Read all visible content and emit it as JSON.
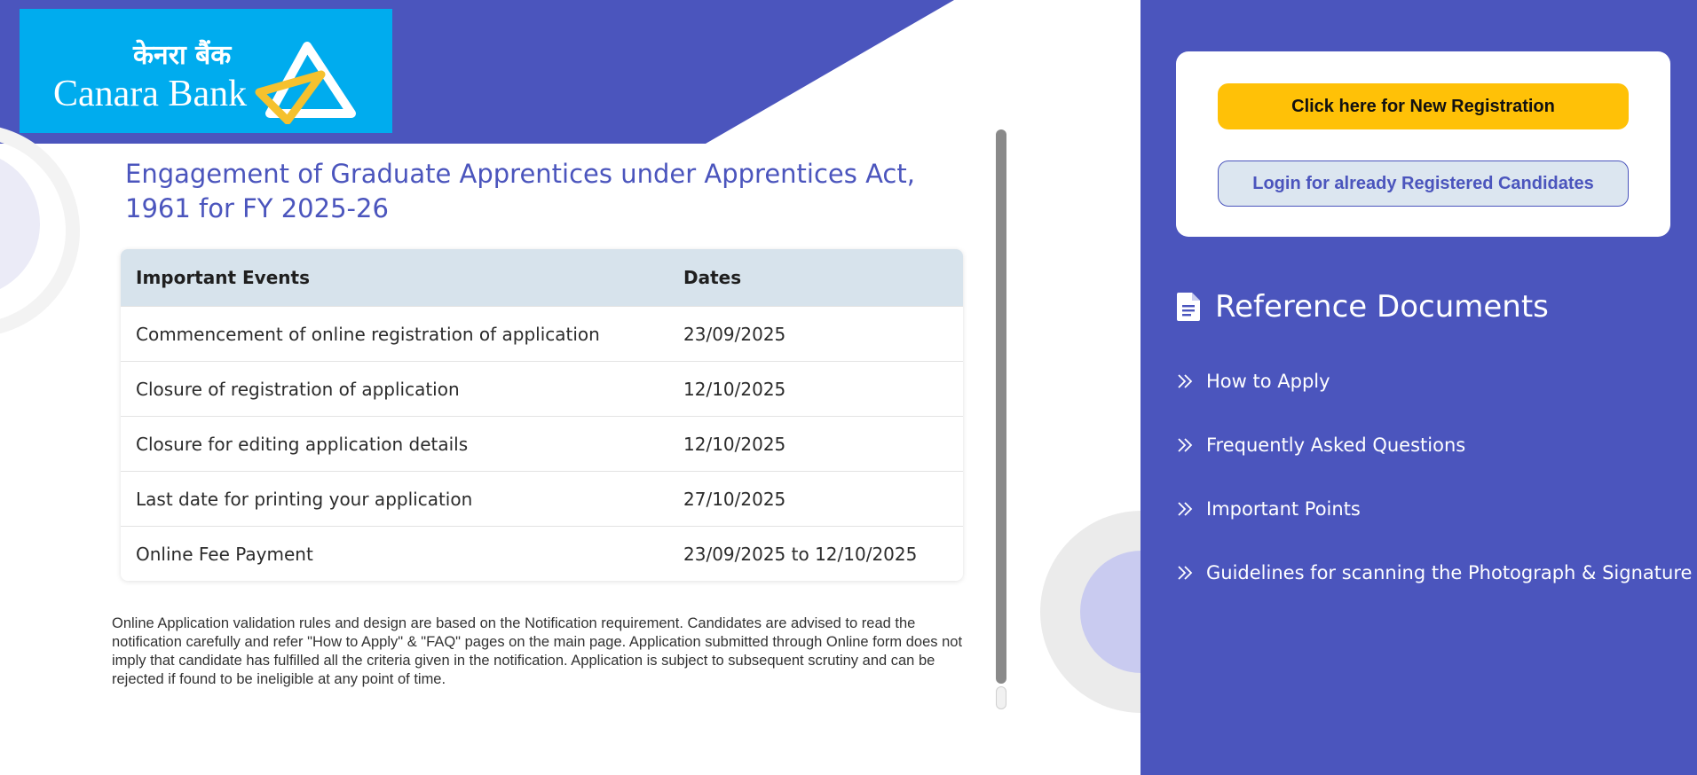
{
  "logo": {
    "hindi": "केनरा बैंक",
    "english": "Canara Bank"
  },
  "page": {
    "title": "Engagement of Graduate Apprentices under Apprentices Act, 1961 for FY 2025-26"
  },
  "table": {
    "headers": [
      "Important Events",
      "Dates"
    ],
    "rows": [
      {
        "event": "Commencement of online registration of application",
        "date": "23/09/2025"
      },
      {
        "event": "Closure of registration of application",
        "date": "12/10/2025"
      },
      {
        "event": "Closure for editing application details",
        "date": "12/10/2025"
      },
      {
        "event": "Last date for printing your application",
        "date": "27/10/2025"
      },
      {
        "event": "Online Fee Payment",
        "date": "23/09/2025 to 12/10/2025"
      }
    ]
  },
  "notice": "Online Application validation rules and design are based on the Notification requirement. Candidates are advised to read the notification carefully and refer \"How to Apply\" & \"FAQ\" pages on the main page. Application submitted through Online form does not imply that candidate has fulfilled all the criteria given in the notification. Application is subject to subsequent scrutiny and can be rejected if found to be ineligible at any point of time.",
  "sidebar": {
    "new_registration_label": "Click here for New Registration",
    "login_label": "Login for already Registered Candidates",
    "reference_heading": "Reference Documents",
    "reference_items": [
      {
        "label": "How to Apply",
        "icon": "double-chevron-right-icon"
      },
      {
        "label": "Frequently Asked Questions",
        "icon": "double-chevron-right-icon"
      },
      {
        "label": "Important Points",
        "icon": "double-chevron-right-icon"
      },
      {
        "label": "Guidelines for scanning the Photograph & Signature",
        "icon": "double-chevron-right-icon"
      }
    ]
  },
  "colors": {
    "brand_purple": "#4b55bd",
    "accent_yellow": "#ffc107",
    "logo_blue": "#00acee",
    "table_header": "#d7e3ec"
  }
}
